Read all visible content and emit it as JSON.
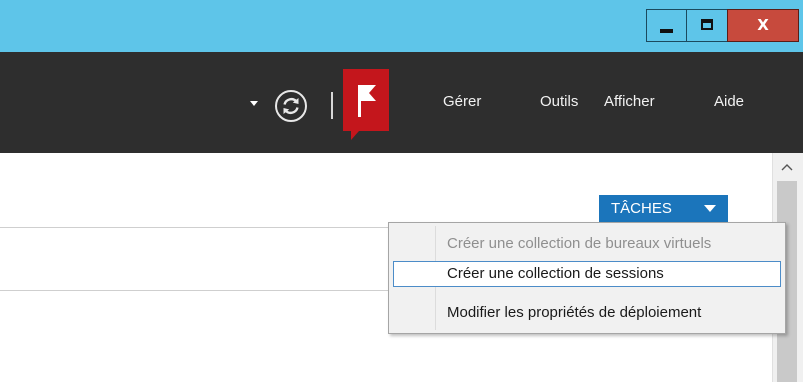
{
  "window": {
    "minimize_icon": "minimize-icon",
    "maximize_icon": "maximize-icon",
    "close_label": "X"
  },
  "toolbar": {
    "refresh_icon": "refresh-icon",
    "notifications_icon": "flag-icon",
    "menu": {
      "gerer": "Gérer",
      "outils": "Outils",
      "afficher": "Afficher",
      "aide": "Aide"
    }
  },
  "tasks": {
    "label": "TÂCHES"
  },
  "context_menu": {
    "items": [
      {
        "label": "Créer une collection de bureaux virtuels",
        "enabled": false
      },
      {
        "label": "Créer une collection de sessions",
        "enabled": true,
        "highlighted": true
      },
      {
        "label": "Modifier les propriétés de déploiement",
        "enabled": true
      }
    ]
  },
  "colors": {
    "titlebar": "#5ec5e9",
    "toolbar": "#2e2e2e",
    "close_button": "#c74a3d",
    "flag_badge": "#c4161c",
    "tasks_button": "#1b75bb",
    "highlight_border": "#4c8cc8"
  }
}
